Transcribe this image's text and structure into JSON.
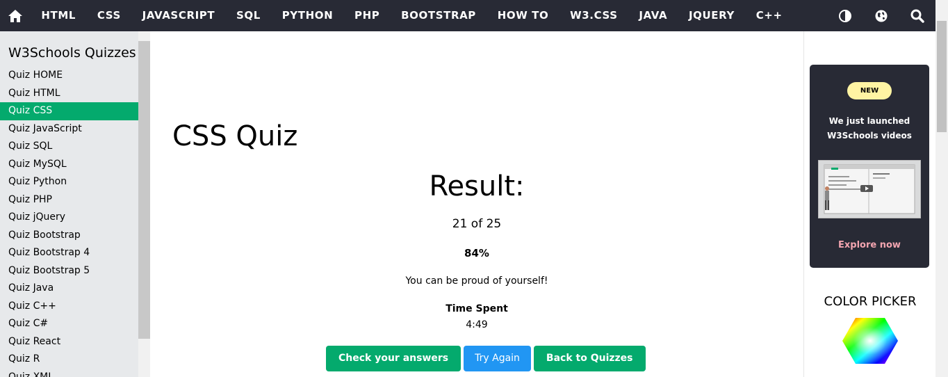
{
  "topnav": {
    "items": [
      "HTML",
      "CSS",
      "JAVASCRIPT",
      "SQL",
      "PYTHON",
      "PHP",
      "BOOTSTRAP",
      "HOW TO",
      "W3.CSS",
      "JAVA",
      "JQUERY",
      "C++"
    ],
    "icons": [
      "home-icon",
      "contrast-icon",
      "globe-icon",
      "search-icon"
    ],
    "colors": {
      "background": "#282a35",
      "text": "#ffffff"
    }
  },
  "sidebar": {
    "title": "W3Schools Quizzes",
    "items": [
      {
        "label": "Quiz HOME"
      },
      {
        "label": "Quiz HTML"
      },
      {
        "label": "Quiz CSS",
        "active": true
      },
      {
        "label": "Quiz JavaScript"
      },
      {
        "label": "Quiz SQL"
      },
      {
        "label": "Quiz MySQL"
      },
      {
        "label": "Quiz Python"
      },
      {
        "label": "Quiz PHP"
      },
      {
        "label": "Quiz jQuery"
      },
      {
        "label": "Quiz Bootstrap"
      },
      {
        "label": "Quiz Bootstrap 4"
      },
      {
        "label": "Quiz Bootstrap 5"
      },
      {
        "label": "Quiz Java"
      },
      {
        "label": "Quiz C++"
      },
      {
        "label": "Quiz C#"
      },
      {
        "label": "Quiz React"
      },
      {
        "label": "Quiz R"
      },
      {
        "label": "Quiz XML"
      }
    ],
    "colors": {
      "background": "#e7e9eb",
      "active": "#04aa6d"
    }
  },
  "main": {
    "title": "CSS Quiz",
    "result_heading": "Result:",
    "score": "21 of 25",
    "percent": "84%",
    "message": "You can be proud of yourself!",
    "time_label": "Time Spent",
    "time_value": "4:49",
    "buttons": {
      "check": "Check your answers",
      "try_again": "Try Again",
      "back": "Back to Quizzes"
    },
    "colors": {
      "green": "#04aa6d",
      "blue": "#2196f3"
    }
  },
  "promo": {
    "badge": "NEW",
    "line1": "We just launched",
    "line2": "W3Schools videos",
    "explore": "Explore now",
    "colors": {
      "background": "#282a35",
      "badge": "#fff4a3",
      "explore": "#f3a5b0"
    }
  },
  "color_picker": {
    "title": "COLOR PICKER"
  }
}
